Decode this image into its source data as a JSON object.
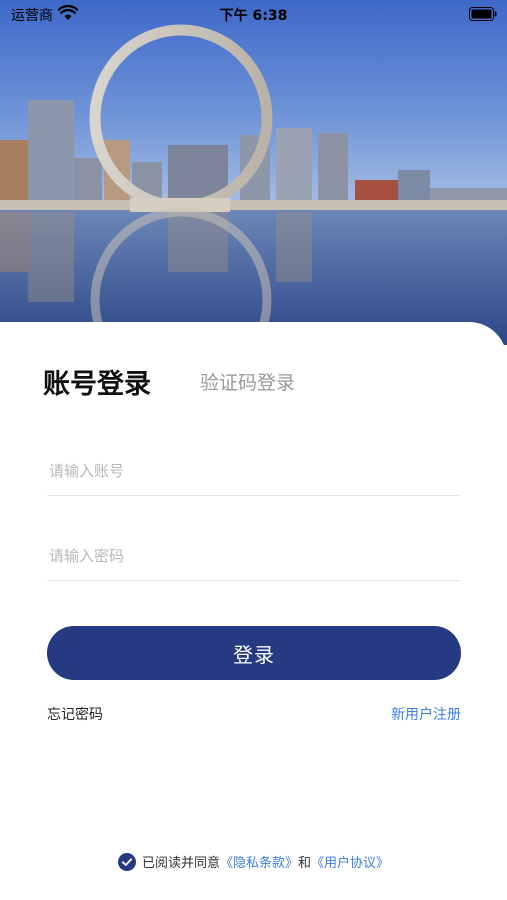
{
  "status_bar": {
    "carrier": "运营商",
    "time": "下午 6:38"
  },
  "tabs": {
    "account_login": "账号登录",
    "sms_login": "验证码登录"
  },
  "form": {
    "account_placeholder": "请输入账号",
    "password_placeholder": "请输入密码",
    "account_value": "",
    "password_value": ""
  },
  "buttons": {
    "login": "登录",
    "forgot_password": "忘记密码",
    "register": "新用户注册"
  },
  "agreement": {
    "prefix": "已阅读并同意",
    "privacy": "《隐私条款》",
    "and": "和",
    "user_agreement": "《用户协议》",
    "checked": true
  },
  "colors": {
    "primary": "#263a83",
    "link": "#3d7fe0",
    "muted": "#9a9a9a"
  }
}
